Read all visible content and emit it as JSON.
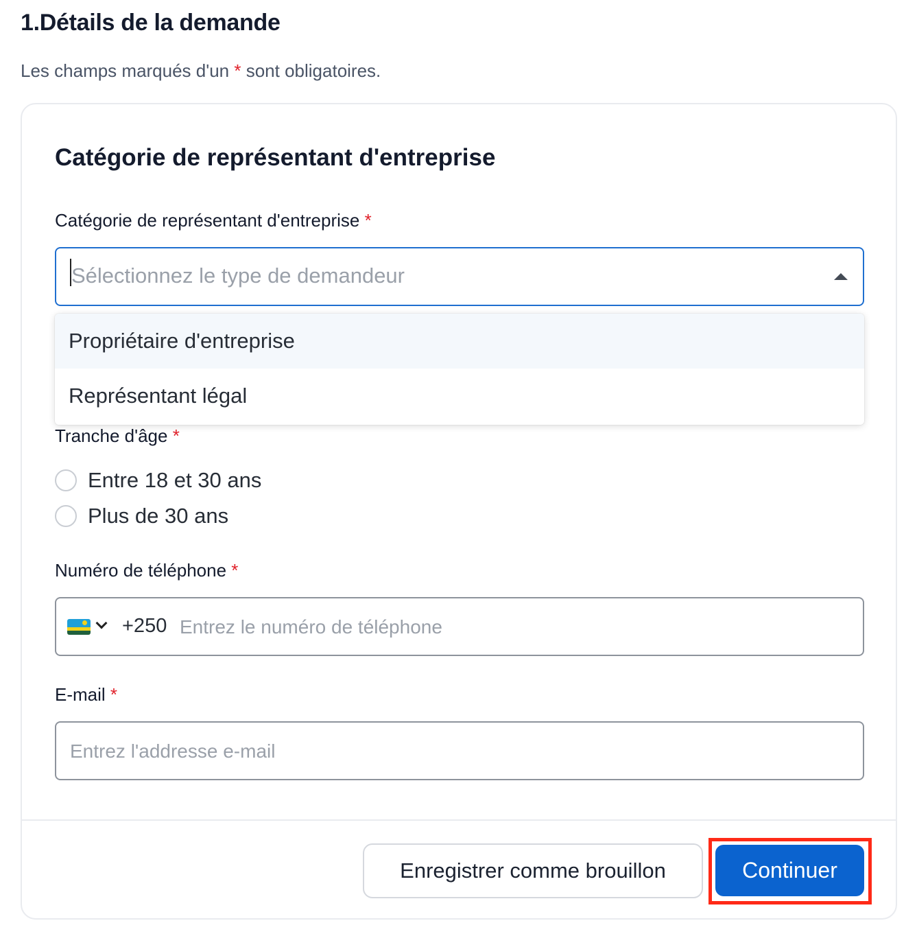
{
  "header": {
    "title": "1.Détails de la demande",
    "note_before": "Les champs marqués d'un ",
    "note_star": "*",
    "note_after": " sont obligatoires."
  },
  "card": {
    "title": "Catégorie de représentant d'entreprise",
    "category": {
      "label": "Catégorie de représentant d'entreprise",
      "required_mark": "*",
      "placeholder": "Sélectionnez le type de demandeur",
      "options": [
        "Propriétaire d'entreprise",
        "Représentant légal"
      ]
    },
    "age": {
      "label": "Tranche d'âge",
      "required_mark": "*",
      "options": [
        "Entre 18 et 30 ans",
        "Plus de 30 ans"
      ]
    },
    "phone": {
      "label": "Numéro de téléphone",
      "required_mark": "*",
      "country_flag": "rwanda-flag-icon",
      "dial_code": "+250",
      "placeholder": "Entrez le numéro de téléphone"
    },
    "email": {
      "label": "E-mail",
      "required_mark": "*",
      "placeholder": "Entrez l'addresse e-mail"
    }
  },
  "footer": {
    "draft_label": "Enregistrer comme brouillon",
    "continue_label": "Continuer"
  },
  "colors": {
    "primary": "#0b63cf",
    "required": "#e0212a",
    "highlight": "#ff2a17"
  }
}
